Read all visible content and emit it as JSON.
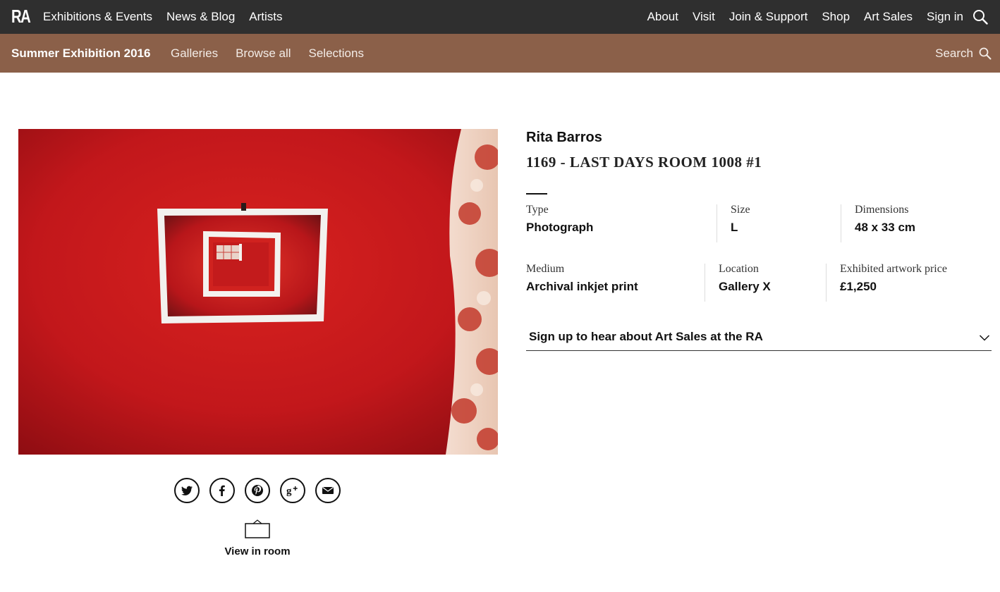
{
  "topbar": {
    "logo": "RA",
    "left_links": [
      "Exhibitions & Events",
      "News & Blog",
      "Artists"
    ],
    "right_links": [
      "About",
      "Visit",
      "Join & Support",
      "Shop",
      "Art Sales",
      "Sign in"
    ]
  },
  "subbar": {
    "title": "Summer Exhibition 2016",
    "links": [
      "Galleries",
      "Browse all",
      "Selections"
    ],
    "search_label": "Search"
  },
  "artwork": {
    "artist": "Rita Barros",
    "title": "1169 - LAST DAYS ROOM 1008 #1",
    "details": {
      "type_label": "Type",
      "type_value": "Photograph",
      "size_label": "Size",
      "size_value": "L",
      "dimensions_label": "Dimensions",
      "dimensions_value": "48 x 33 cm",
      "medium_label": "Medium",
      "medium_value": "Archival inkjet print",
      "location_label": "Location",
      "location_value": "Gallery X",
      "price_label": "Exhibited artwork price",
      "price_value": "£1,250"
    }
  },
  "signup": {
    "label": "Sign up to hear about Art Sales at the RA"
  },
  "share": {
    "icons": [
      "twitter-icon",
      "facebook-icon",
      "pinterest-icon",
      "google-plus-icon",
      "email-icon"
    ]
  },
  "view_room": {
    "label": "View in room"
  },
  "colors": {
    "topbar": "#2f2f2f",
    "subbar": "#8b6049",
    "artwork_red": "#c8161c"
  }
}
